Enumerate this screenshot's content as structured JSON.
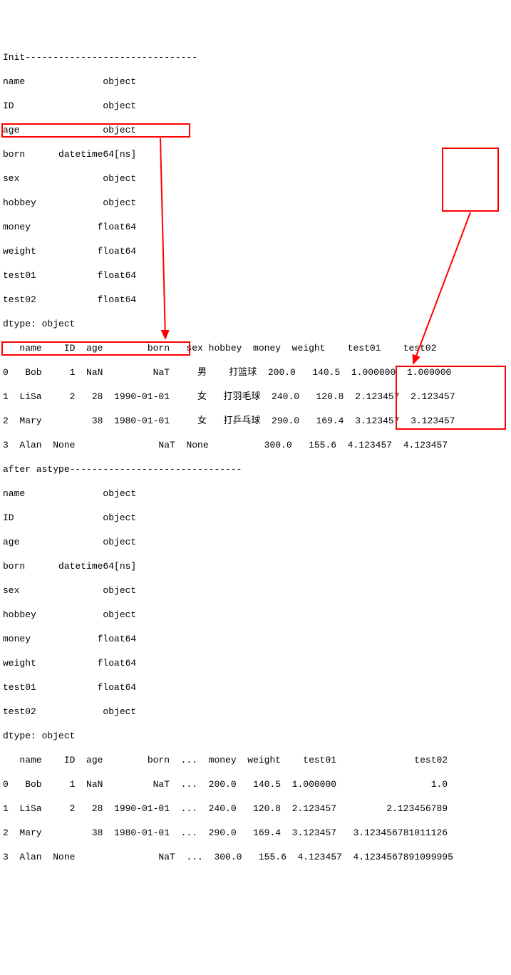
{
  "section1_header": "Init-------------------------------",
  "dtypes1": [
    "name              object",
    "ID                object",
    "age               object",
    "born      datetime64[ns]",
    "sex               object",
    "hobbey            object",
    "money            float64",
    "weight           float64",
    "test01           float64",
    "test02           float64"
  ],
  "dtype_footer1": "dtype: object",
  "table1_header": "   name    ID  age        born   sex hobbey  money  weight    test01    test02",
  "table1_rows": [
    "0   Bob     1  NaN         NaT     男    打篮球  200.0   140.5  1.000000  1.000000",
    "1  LiSa     2   28  1990-01-01     女   打羽毛球  240.0   120.8  2.123457  2.123457",
    "2  Mary         38  1980-01-01     女   打乒乓球  290.0   169.4  3.123457  3.123457",
    "3  Alan  None               NaT  None          300.0   155.6  4.123457  4.123457"
  ],
  "section2_header": "after astype-------------------------------",
  "dtypes2": [
    "name              object",
    "ID                object",
    "age               object",
    "born      datetime64[ns]",
    "sex               object",
    "hobbey            object",
    "money            float64",
    "weight           float64",
    "test01           float64",
    "test02            object"
  ],
  "dtype_footer2": "dtype: object",
  "table2_header": "   name    ID  age        born  ...  money  weight    test01              test02",
  "table2_rows": [
    "0   Bob     1  NaN         NaT  ...  200.0   140.5  1.000000                 1.0",
    "1  LiSa     2   28  1990-01-01  ...  240.0   120.8  2.123457         2.123456789",
    "2  Mary         38  1980-01-01  ...  290.0   169.4  3.123457   3.123456781011126",
    "3  Alan  None               NaT  ...  300.0   155.6  4.123457  4.1234567891099995"
  ]
}
